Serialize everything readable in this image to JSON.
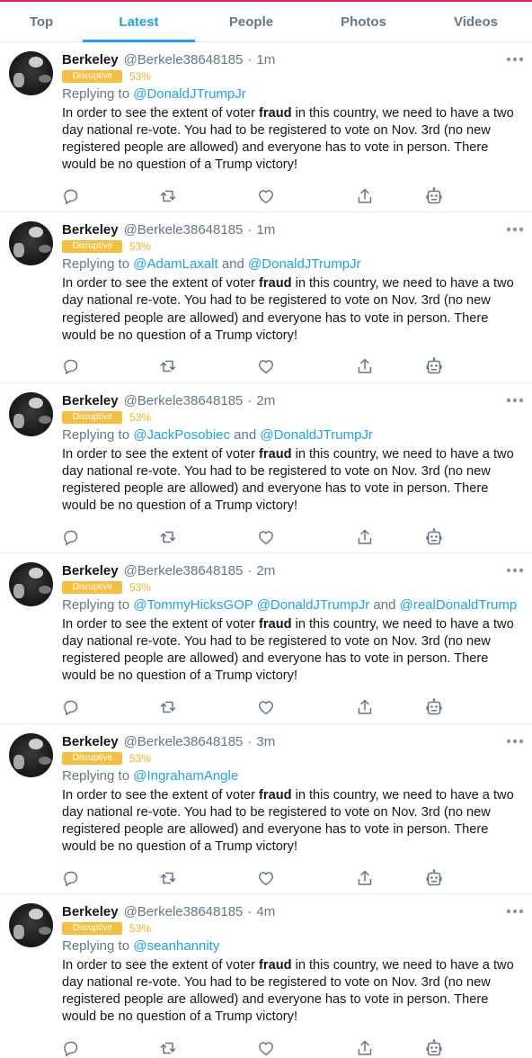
{
  "tabs": [
    {
      "label": "Top"
    },
    {
      "label": "Latest"
    },
    {
      "label": "People"
    },
    {
      "label": "Photos"
    },
    {
      "label": "Videos"
    }
  ],
  "colors": {
    "accent": "#1da1f2",
    "badge": "#f5c042",
    "percent": "#f3b221",
    "muted": "#657786"
  },
  "icons": [
    "reply-icon",
    "retweet-icon",
    "like-icon",
    "share-icon",
    "bot-icon",
    "more-icon"
  ],
  "tweets": [
    {
      "name": "Berkeley",
      "handle": "@Berkele38648185",
      "sep": "·",
      "time": "1m",
      "badge": "Disruptive",
      "percent": "53%",
      "replying_prefix": "Replying to ",
      "mentions": [
        "@DonaldJTrumpJr"
      ],
      "joiners": [],
      "text_before": "In order to see the extent of voter ",
      "text_bold": "fraud",
      "text_after": " in this country, we need to have a two day national re-vote.  You had to be registered to vote on Nov. 3rd (no new registered people are allowed) and everyone has to vote in person.  There would be no question of a Trump victory!"
    },
    {
      "name": "Berkeley",
      "handle": "@Berkele38648185",
      "sep": "·",
      "time": "1m",
      "badge": "Disruptive",
      "percent": "53%",
      "replying_prefix": "Replying to ",
      "mentions": [
        "@AdamLaxalt",
        "@DonaldJTrumpJr"
      ],
      "joiners": [
        " and "
      ],
      "text_before": "In order to see the extent of voter ",
      "text_bold": "fraud",
      "text_after": " in this country, we need to have a two day national re-vote.  You had to be registered to vote on Nov. 3rd (no new registered people are allowed) and everyone has to vote in person.  There would be no question of a Trump victory!"
    },
    {
      "name": "Berkeley",
      "handle": "@Berkele38648185",
      "sep": "·",
      "time": "2m",
      "badge": "Disruptive",
      "percent": "53%",
      "replying_prefix": "Replying to ",
      "mentions": [
        "@JackPosobiec",
        "@DonaldJTrumpJr"
      ],
      "joiners": [
        " and "
      ],
      "text_before": "In order to see the extent of voter ",
      "text_bold": "fraud",
      "text_after": " in this country, we need to have a two day national re-vote.  You had to be registered to vote on Nov. 3rd (no new registered people are allowed) and everyone has to vote in person.  There would be no question of a Trump victory!"
    },
    {
      "name": "Berkeley",
      "handle": "@Berkele38648185",
      "sep": "·",
      "time": "2m",
      "badge": "Disruptive",
      "percent": "53%",
      "replying_prefix": "Replying to ",
      "mentions": [
        "@TommyHicksGOP",
        "@DonaldJTrumpJr",
        "@realDonaldTrump"
      ],
      "joiners": [
        " ",
        " and "
      ],
      "text_before": "In order to see the extent of voter ",
      "text_bold": "fraud",
      "text_after": " in this country, we need to have a two day national re-vote.  You had to be registered to vote on Nov. 3rd (no new registered people are allowed) and everyone has to vote in person.  There would be no question of a Trump victory!"
    },
    {
      "name": "Berkeley",
      "handle": "@Berkele38648185",
      "sep": "·",
      "time": "3m",
      "badge": "Disruptive",
      "percent": "53%",
      "replying_prefix": "Replying to ",
      "mentions": [
        "@IngrahamAngle"
      ],
      "joiners": [],
      "text_before": "In order to see the extent of voter ",
      "text_bold": "fraud",
      "text_after": " in this country, we need to have a two day national re-vote.  You had to be registered to vote on Nov. 3rd (no new registered people are allowed) and everyone has to vote in person.  There would be no question of a Trump victory!"
    },
    {
      "name": "Berkeley",
      "handle": "@Berkele38648185",
      "sep": "·",
      "time": "4m",
      "badge": "Disruptive",
      "percent": "53%",
      "replying_prefix": "Replying to ",
      "mentions": [
        "@seanhannity"
      ],
      "joiners": [],
      "text_before": "In order to see the extent of voter ",
      "text_bold": "fraud",
      "text_after": " in this country, we need to have a two day national re-vote.  You had to be registered to vote on Nov. 3rd (no new registered people are allowed) and everyone has to vote in person.  There would be no question of a Trump victory!"
    }
  ]
}
